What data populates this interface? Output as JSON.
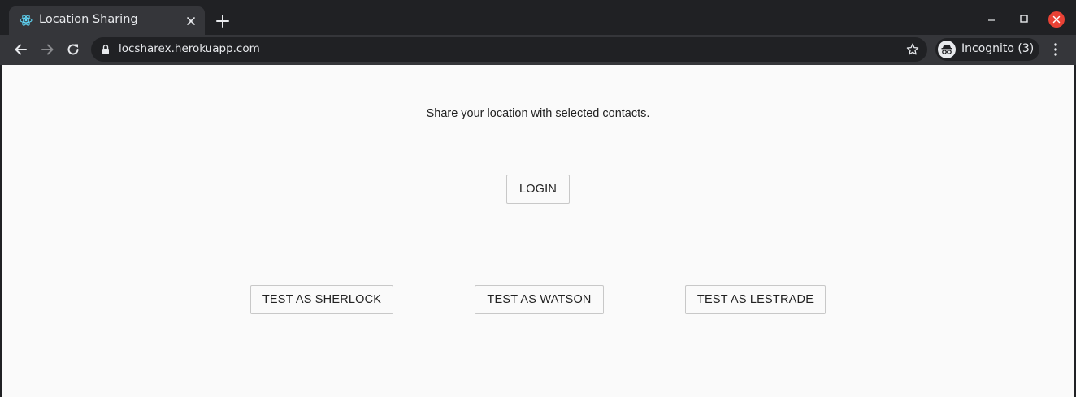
{
  "browser": {
    "tab": {
      "title": "Location Sharing",
      "favicon": "react-logo-icon"
    },
    "address_bar": {
      "url": "locsharex.herokuapp.com"
    },
    "profile": {
      "label": "Incognito (3)"
    },
    "colors": {
      "frame": "#202124",
      "toolbar": "#35363a",
      "close_button": "#e94235",
      "favicon": "#61dafb"
    }
  },
  "page": {
    "tagline": "Share your location with selected contacts.",
    "login_label": "LOGIN",
    "test_buttons": [
      {
        "label": "TEST AS SHERLOCK"
      },
      {
        "label": "TEST AS WATSON"
      },
      {
        "label": "TEST AS LESTRADE"
      }
    ]
  }
}
